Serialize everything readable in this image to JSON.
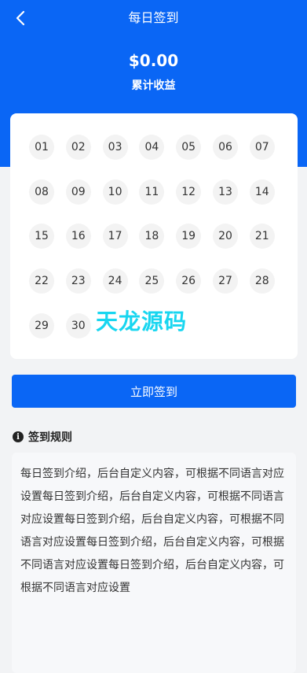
{
  "nav": {
    "title": "每日签到"
  },
  "summary": {
    "amount": "$0.00",
    "label": "累计收益"
  },
  "calendar": {
    "days": [
      "01",
      "02",
      "03",
      "04",
      "05",
      "06",
      "07",
      "08",
      "09",
      "10",
      "11",
      "12",
      "13",
      "14",
      "15",
      "16",
      "17",
      "18",
      "19",
      "20",
      "21",
      "22",
      "23",
      "24",
      "25",
      "26",
      "27",
      "28",
      "29",
      "30"
    ]
  },
  "watermark": "天龙源码",
  "signin_button": "立即签到",
  "rules": {
    "title": "签到规则",
    "text": "每日签到介绍，后台自定义内容，可根据不同语言对应设置每日签到介绍，后台自定义内容，可根据不同语言对应设置每日签到介绍，后台自定义内容，可根据不同语言对应设置每日签到介绍，后台自定义内容，可根据不同语言对应设置每日签到介绍，后台自定义内容，可根据不同语言对应设置"
  },
  "colors": {
    "primary": "#0a66f5",
    "watermark": "#18d6f0",
    "day_bg": "#f3f3f3"
  }
}
